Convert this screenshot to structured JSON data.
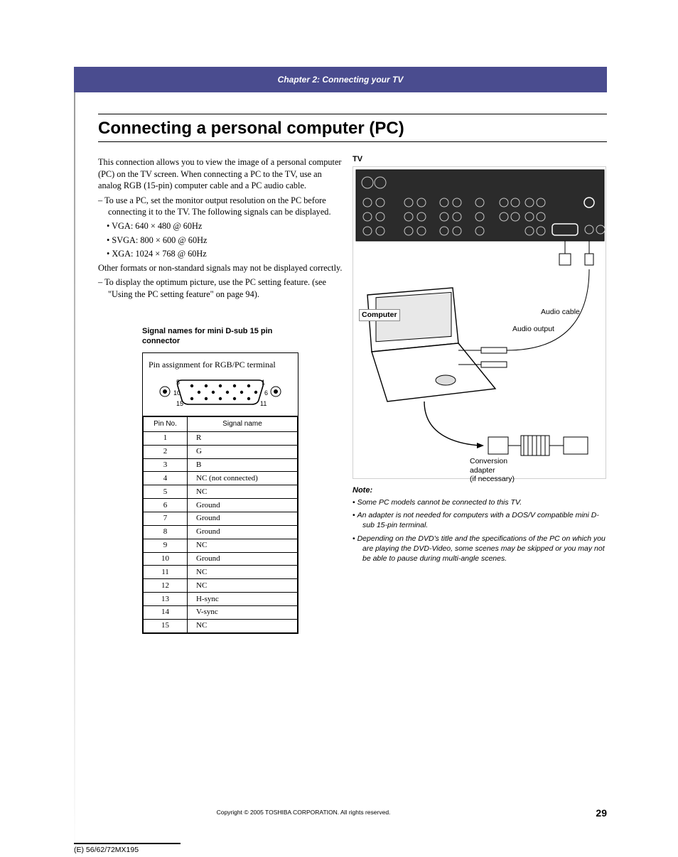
{
  "header": {
    "chapter": "Chapter 2: Connecting your TV"
  },
  "title": "Connecting a personal computer (PC)",
  "left": {
    "intro": "This connection allows you to view the image of a personal computer (PC) on the TV screen. When connecting a PC to the TV, use an analog RGB (15-pin) computer cable and a PC audio cable.",
    "dash1": "To use a PC, set the monitor output resolution on the PC before connecting it to the TV. The following signals can be displayed.",
    "m1": "VGA: 640 × 480 @ 60Hz",
    "m2": "SVGA: 800 × 600 @ 60Hz",
    "m3": "XGA: 1024 × 768 @ 60Hz",
    "p2": "Other formats or non-standard signals may not be displayed correctly.",
    "dash2": "To display the optimum picture, use the PC setting feature. (see \"Using the PC setting feature\" on page 94).",
    "sigcap": "Signal names for mini D-sub 15 pin connector",
    "connlbl": "Pin assignment for RGB/PC terminal",
    "conn_n": {
      "a": "5",
      "b": "10",
      "c": "15",
      "d": "1",
      "e": "6",
      "f": "11"
    },
    "th1": "Pin No.",
    "th2": "Signal name"
  },
  "pins": [
    {
      "n": "1",
      "s": "R"
    },
    {
      "n": "2",
      "s": "G"
    },
    {
      "n": "3",
      "s": "B"
    },
    {
      "n": "4",
      "s": "NC (not connected)"
    },
    {
      "n": "5",
      "s": "NC"
    },
    {
      "n": "6",
      "s": "Ground"
    },
    {
      "n": "7",
      "s": "Ground"
    },
    {
      "n": "8",
      "s": "Ground"
    },
    {
      "n": "9",
      "s": "NC"
    },
    {
      "n": "10",
      "s": "Ground"
    },
    {
      "n": "11",
      "s": "NC"
    },
    {
      "n": "12",
      "s": "NC"
    },
    {
      "n": "13",
      "s": "H-sync"
    },
    {
      "n": "14",
      "s": "V-sync"
    },
    {
      "n": "15",
      "s": "NC"
    }
  ],
  "right": {
    "tv": "TV",
    "computer": "Computer",
    "audio_out": "Audio output",
    "audio_cable": "Audio cable",
    "conv1": "Conversion",
    "conv2": "adapter",
    "conv3": "(if necessary)",
    "note_hdr": "Note:",
    "n1": "Some PC models cannot be connected to this TV.",
    "n2": "An adapter is not needed for computers with a DOS/V compatible mini D-sub 15-pin terminal.",
    "n3": "Depending on the DVD's title and the specifications of the PC on which you are playing the DVD-Video, some scenes may be skipped or you may not be able to pause during multi-angle scenes."
  },
  "footer": {
    "copyright": "Copyright © 2005 TOSHIBA CORPORATION. All rights reserved.",
    "page": "29",
    "docid": "(E) 56/62/72MX195"
  }
}
